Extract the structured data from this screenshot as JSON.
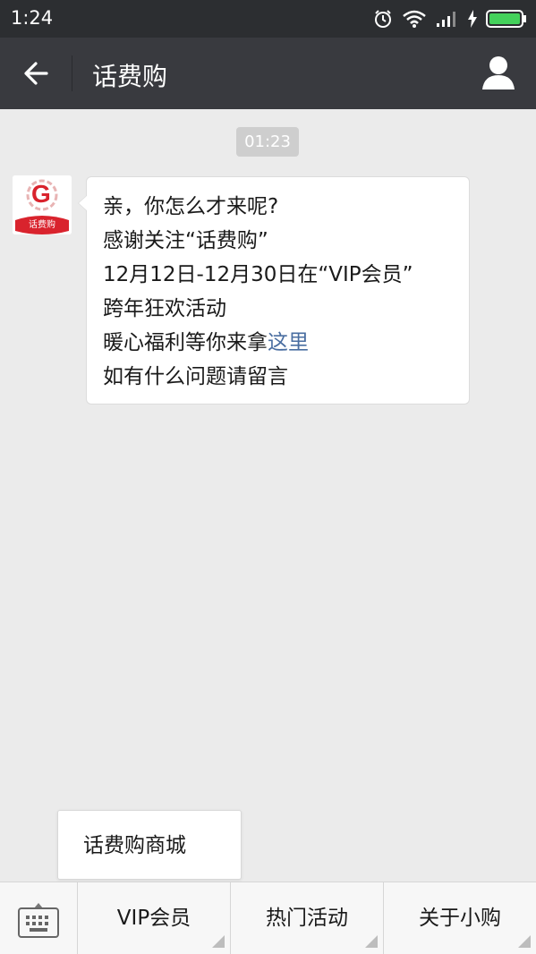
{
  "status_bar": {
    "time": "1:24"
  },
  "header": {
    "title": "话费购"
  },
  "chat": {
    "timestamp": "01:23",
    "avatar_label": "话费购",
    "avatar_letter": "G",
    "message": {
      "lines": [
        "亲，你怎么才来呢?",
        "感谢关注“话费购”",
        "12月12日-12月30日在“VIP会员”",
        "跨年狂欢活动"
      ],
      "line5_prefix": "暖心福利等你来拿",
      "line5_link": "这里",
      "line6": "如有什么问题请留言"
    }
  },
  "popup_menu": {
    "item": "话费购商城"
  },
  "bottom_menu": {
    "items": [
      {
        "label": "VIP会员"
      },
      {
        "label": "热门活动"
      },
      {
        "label": "关于小购"
      }
    ]
  },
  "colors": {
    "header_bg": "#393a3f",
    "status_bg": "#2c2e31",
    "chat_bg": "#ebebeb",
    "link": "#4a6ea1",
    "battery": "#44d15b",
    "brand_red": "#d9232d"
  }
}
